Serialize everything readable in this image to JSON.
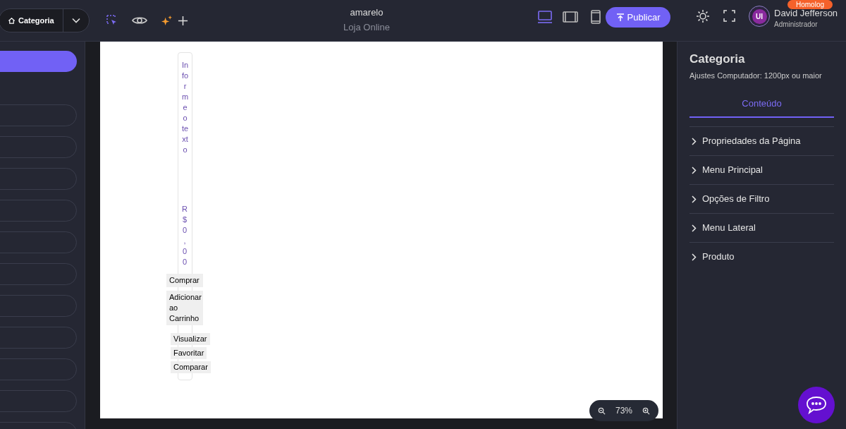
{
  "breadcrumb": {
    "label": "Categoria"
  },
  "site": {
    "name": "amarelo",
    "subtitle": "Loja Online"
  },
  "devices": [
    {
      "kind": "desktop",
      "selected": true
    },
    {
      "kind": "tablet",
      "selected": false
    },
    {
      "kind": "mobile",
      "selected": false
    }
  ],
  "publish_button": "Publicar",
  "environment_badge": "Homolog",
  "user": {
    "name": "David Jefferson",
    "role": "Administrador",
    "avatar_text": "UI"
  },
  "sidebar": {
    "items": [
      {
        "selected": true
      },
      {
        "selected": false
      },
      {
        "selected": false
      },
      {
        "selected": false
      },
      {
        "selected": false
      },
      {
        "selected": false
      },
      {
        "selected": false
      },
      {
        "selected": false
      },
      {
        "selected": false
      },
      {
        "selected": false
      },
      {
        "selected": false
      },
      {
        "selected": false
      }
    ]
  },
  "product_card": {
    "name": "Informe o texto",
    "price": "R$0,00",
    "buttons": [
      {
        "label": "Comprar",
        "kind": "primary"
      },
      {
        "label": "Adicionar ao Carrinho",
        "kind": "primary"
      },
      {
        "label": "Visualizar",
        "kind": "secondary"
      },
      {
        "label": "Favoritar",
        "kind": "secondary"
      },
      {
        "label": "Comparar",
        "kind": "secondary"
      }
    ]
  },
  "zoom": "73%",
  "panel": {
    "title": "Categoria",
    "subtitle": "Ajustes Computador: 1200px ou maior",
    "tabs": [
      {
        "label": "Conteúdo",
        "selected": true
      }
    ],
    "sections": [
      {
        "label": "Propriedades da Página",
        "expanded": false
      },
      {
        "label": "Menu Principal",
        "expanded": false
      },
      {
        "label": "Opções de Filtro",
        "expanded": false
      },
      {
        "label": "Menu Lateral",
        "expanded": false
      },
      {
        "label": "Produto",
        "expanded": false
      }
    ]
  }
}
